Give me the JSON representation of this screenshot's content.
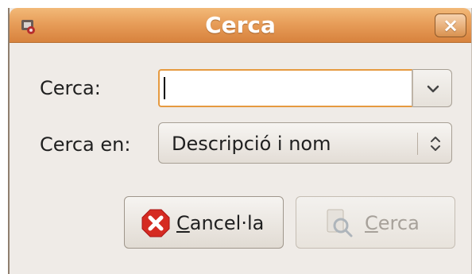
{
  "window": {
    "title": "Cerca"
  },
  "form": {
    "search_label": "Cerca:",
    "search_value": "",
    "search_in_label": "Cerca en:",
    "search_in_value": "Descripció i nom"
  },
  "buttons": {
    "cancel_mnemonic": "C",
    "cancel_rest": "ancel·la",
    "search_mnemonic": "C",
    "search_rest": "erca"
  },
  "icons": {
    "app": "app-icon",
    "close": "close-icon",
    "dropdown": "chevron-down-icon",
    "combo": "up-down-chevron-icon",
    "cancel": "cancel-icon",
    "search": "search-icon"
  },
  "colors": {
    "titlebar": "#e79d59",
    "focus_border": "#e69a40",
    "window_bg": "#efebe7",
    "cancel_red": "#d52b22"
  }
}
